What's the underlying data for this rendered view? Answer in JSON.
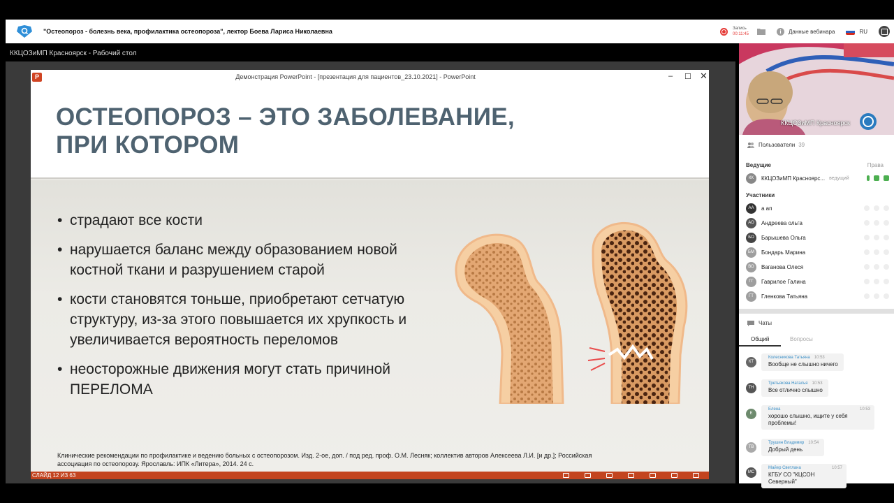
{
  "header": {
    "title": "\"Остеопороз - болезнь века, профилактика остеопороза\", лектор Боева Лариса Николаевна",
    "record_label": "Запись",
    "record_time": "00:11:45",
    "webinar_data": "Данные вебинара",
    "lang": "RU"
  },
  "desktop_label": "ККЦОЗиМП Красноярск - Рабочий стол",
  "ppt": {
    "window_title": "Демонстрация PowerPoint - [презентация для пациентов_23.10.2021] - PowerPoint",
    "slide_counter": "СЛАЙД 12 ИЗ 63"
  },
  "slide": {
    "title_line1": "ОСТЕОПОРОЗ – ЭТО ЗАБОЛЕВАНИЕ,",
    "title_line2": "ПРИ КОТОРОМ",
    "bullets": [
      "страдают все кости",
      "нарушается баланс между образованием новой костной ткани и разрушением старой",
      "кости становятся тоньше, приобретают сетчатую структуру, из-за этого повышается их хрупкость и увеличивается вероятность переломов",
      "неосторожные движения могут стать причиной ПЕРЕЛОМА"
    ],
    "reference": "Клинические рекомендации по профилактике и ведению больных с остеопорозом. Изд. 2-ое, доп. / под ред. проф. О.М. Лесняк; коллектив авторов Алексеева Л.И. [и др.]; Российская ассоциация по остеопорозу. Ярославль: ИПК «Литера», 2014. 24 с."
  },
  "video": {
    "label": "ККЦОЗиМП Красноярск"
  },
  "users": {
    "title": "Пользователи",
    "count": "39",
    "hosts_label": "Ведущие",
    "rights_label": "Права",
    "host": {
      "initials": "КК",
      "name": "ККЦОЗиМП Красноярс...",
      "role": "ведущий"
    },
    "participants_label": "Участники",
    "participants": [
      {
        "initials": "АА",
        "name": "а ап"
      },
      {
        "initials": "АО",
        "name": "Андреева ольга"
      },
      {
        "initials": "БО",
        "name": "Барышева Ольга"
      },
      {
        "initials": "БМ",
        "name": "Бондарь Марина"
      },
      {
        "initials": "ВО",
        "name": "Ваганова Олеся"
      },
      {
        "initials": "ГГ",
        "name": "Гаврилое Галина"
      },
      {
        "initials": "ГТ",
        "name": "Гленкова Татьяна"
      }
    ]
  },
  "chat": {
    "title": "Чаты",
    "tab_general": "Общий",
    "tab_questions": "Вопросы",
    "messages": [
      {
        "initials": "КТ",
        "author": "Колесникова Татьяна",
        "time": "10:53",
        "text": "Вообще не слышно ничего"
      },
      {
        "initials": "ТН",
        "author": "Третьякова Наталья",
        "time": "10:53",
        "text": "Все отлично слышно"
      },
      {
        "initials": "Е",
        "author": "Елена",
        "time": "10:53",
        "text": "хорошо слышно, ищите у себя проблемы!"
      },
      {
        "initials": "ТВ",
        "author": "Трушин Владимир",
        "time": "10:54",
        "text": "Добрый день"
      },
      {
        "initials": "МС",
        "author": "Майер Светлана",
        "time": "10:57",
        "text": "КГБУ СО \"КЦСОН Северный\""
      }
    ]
  },
  "colors": {
    "accent_orange": "#c3441f",
    "title_slate": "#4e6270",
    "record_red": "#e53935",
    "chat_author_blue": "#3a8fc7"
  }
}
